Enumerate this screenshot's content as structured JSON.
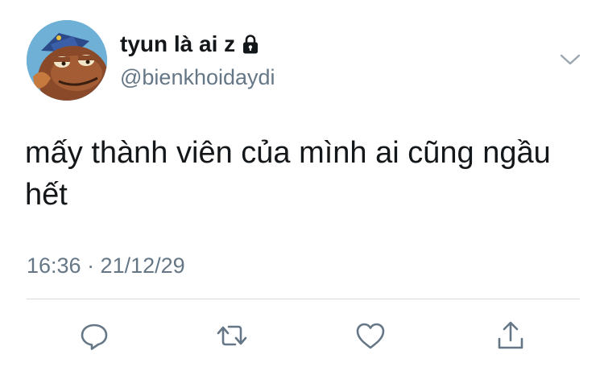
{
  "user": {
    "display_name": "tyun là ai z",
    "handle": "@bienkhoidaydi",
    "protected_icon": "lock-icon",
    "avatar_icon": "cartoon-fish-avatar"
  },
  "tweet": {
    "text": "mấy thành viên của mình ai cũng ngầu hết",
    "timestamp": "16:36 · 21/12/29"
  },
  "menu": {
    "icon": "chevron-down-icon"
  },
  "actions": [
    {
      "name": "reply",
      "icon": "reply-icon"
    },
    {
      "name": "retweet",
      "icon": "retweet-icon"
    },
    {
      "name": "like",
      "icon": "heart-icon"
    },
    {
      "name": "share",
      "icon": "share-icon"
    }
  ],
  "colors": {
    "text_primary": "#14171a",
    "text_secondary": "#657786",
    "icon": "#657786",
    "divider": "#d6dbdf",
    "background": "#ffffff"
  }
}
